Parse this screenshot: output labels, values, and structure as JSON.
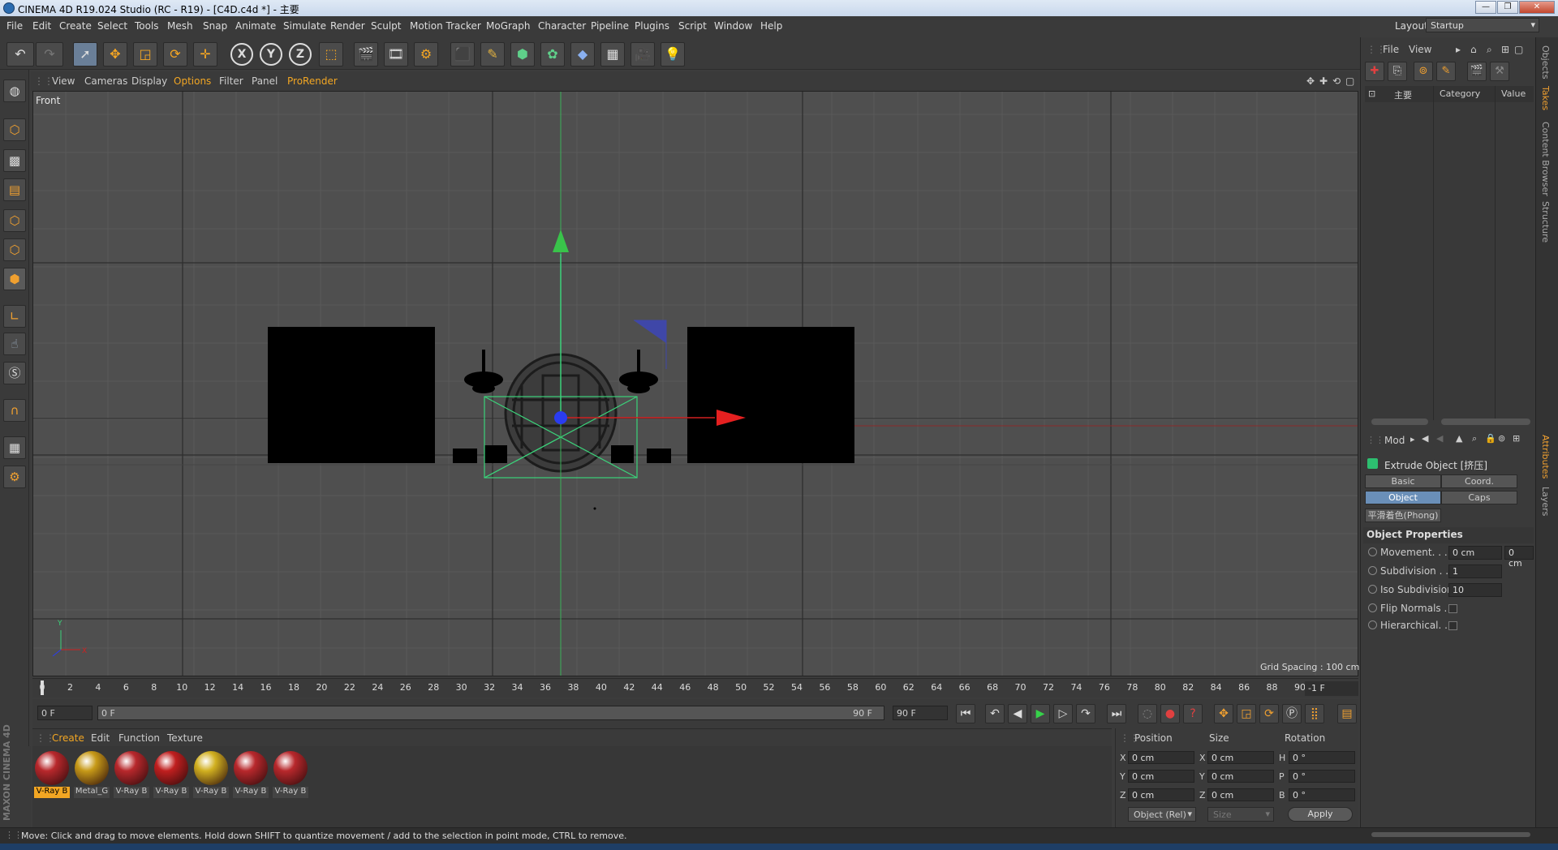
{
  "window": {
    "title": "CINEMA 4D R19.024 Studio (RC - R19) - [C4D.c4d *] - 主要",
    "buttons": [
      "—",
      "❐",
      "✕"
    ]
  },
  "menu": [
    "File",
    "Edit",
    "Create",
    "Select",
    "Tools",
    "Mesh",
    "Snap",
    "Animate",
    "Simulate",
    "Render",
    "Sculpt",
    "Motion Tracker",
    "MoGraph",
    "Character",
    "Pipeline",
    "Plugins",
    "Script",
    "Window",
    "Help"
  ],
  "layout": {
    "label": "Layout:",
    "value": "Startup"
  },
  "toolbar_xyz": [
    "X",
    "Y",
    "Z"
  ],
  "viewport": {
    "menu": [
      "View",
      "Cameras",
      "Display",
      "Options",
      "Filter",
      "Panel",
      "ProRender"
    ],
    "label": "Front",
    "grid_spacing": "Grid Spacing : 100 cm",
    "axis_y": "Y",
    "axis_x": "X"
  },
  "timeline": {
    "ticks": [
      "0",
      "2",
      "4",
      "6",
      "8",
      "10",
      "12",
      "14",
      "16",
      "18",
      "20",
      "22",
      "24",
      "26",
      "28",
      "30",
      "32",
      "34",
      "36",
      "38",
      "40",
      "42",
      "44",
      "46",
      "48",
      "50",
      "52",
      "54",
      "56",
      "58",
      "60",
      "62",
      "64",
      "66",
      "68",
      "70",
      "72",
      "74",
      "76",
      "78",
      "80",
      "82",
      "84",
      "86",
      "88",
      "90"
    ],
    "end_frame": "-1 F",
    "current_frame": "0 F",
    "slider_start": "0 F",
    "slider_end": "90 F",
    "max_frame": "90 F"
  },
  "materials": {
    "menu": [
      "Create",
      "Edit",
      "Function",
      "Texture"
    ],
    "items": [
      {
        "label": "V-Ray B",
        "color": "#b8282c",
        "active": true
      },
      {
        "label": "Metal_G",
        "color": "#c79a18",
        "active": false
      },
      {
        "label": "V-Ray B",
        "color": "#b8282c",
        "active": false
      },
      {
        "label": "V-Ray B",
        "color": "#c01f1f",
        "active": false
      },
      {
        "label": "V-Ray B",
        "color": "#d1b020",
        "active": false
      },
      {
        "label": "V-Ray B",
        "color": "#b8282c",
        "active": false
      },
      {
        "label": "V-Ray B",
        "color": "#b8282c",
        "active": false
      }
    ]
  },
  "coords": {
    "headers": [
      "Position",
      "Size",
      "Rotation"
    ],
    "rows": [
      {
        "axis": "X",
        "pos": "0 cm",
        "size_axis": "X",
        "size": "0 cm",
        "rot_axis": "H",
        "rot": "0 °"
      },
      {
        "axis": "Y",
        "pos": "0 cm",
        "size_axis": "Y",
        "size": "0 cm",
        "rot_axis": "P",
        "rot": "0 °"
      },
      {
        "axis": "Z",
        "pos": "0 cm",
        "size_axis": "Z",
        "size": "0 cm",
        "rot_axis": "B",
        "rot": "0 °"
      }
    ],
    "mode": "Object (Rel)",
    "size_mode": "Size",
    "apply": "Apply"
  },
  "status": "Move: Click and drag to move elements. Hold down SHIFT to quantize movement / add to the selection in point mode, CTRL to remove.",
  "maxon_logo": "MAXON CINEMA 4D",
  "objects": {
    "menu": [
      "File",
      "View"
    ],
    "col_name": "主要",
    "col_category": "Category",
    "col_value": "Value"
  },
  "attributes": {
    "mode": "Mod",
    "title": "Extrude Object [挤压]",
    "tabs": [
      "Basic",
      "Coord.",
      "Object",
      "Caps"
    ],
    "phong_tab": "平滑着色(Phong)",
    "section": "Object Properties",
    "props": [
      {
        "label": "Movement. . . .",
        "value": "0 cm",
        "value2": "0 cm"
      },
      {
        "label": "Subdivision . . .",
        "value": "1"
      },
      {
        "label": "Iso Subdivision",
        "value": "10"
      },
      {
        "label": "Flip Normals . .",
        "checked": false
      },
      {
        "label": "Hierarchical. . .",
        "checked": false
      }
    ]
  },
  "side_tabs": [
    "Objects",
    "Takes",
    "Content Browser",
    "Structure",
    "Attributes",
    "Layers"
  ]
}
